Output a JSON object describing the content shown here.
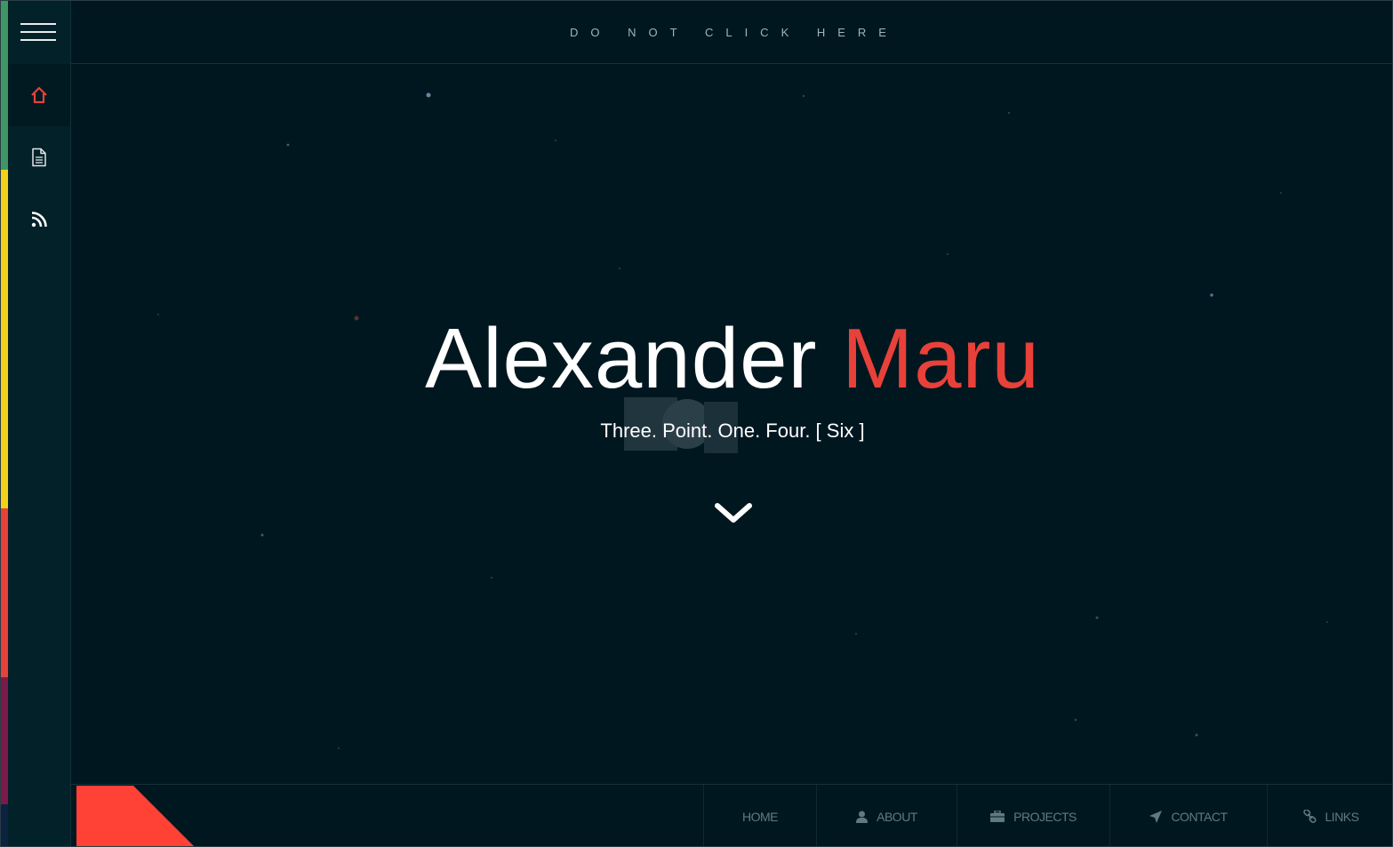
{
  "topbar": {
    "link_label": "DO NOT CLICK HERE"
  },
  "sidebar": {
    "items": [
      {
        "icon": "home-icon",
        "active": true
      },
      {
        "icon": "document-icon",
        "active": false
      },
      {
        "icon": "rss-icon",
        "active": false
      }
    ]
  },
  "hero": {
    "first_name": "Alexander",
    "last_name": "Maru",
    "subtitle": "Three. Point. One. Four. [ Six ]"
  },
  "bottom_nav": {
    "items": [
      {
        "label": "HOME",
        "icon": ""
      },
      {
        "label": "ABOUT",
        "icon": "user-icon"
      },
      {
        "label": "PROJECTS",
        "icon": "briefcase-icon"
      },
      {
        "label": "CONTACT",
        "icon": "paper-plane-icon"
      },
      {
        "label": "LINKS",
        "icon": "link-icon"
      }
    ]
  },
  "colors": {
    "background": "#011720",
    "accent": "#e8413a",
    "strip": [
      "#3f9563",
      "#f3d118",
      "#e8413a",
      "#7a1a4a",
      "#0b2240"
    ]
  }
}
